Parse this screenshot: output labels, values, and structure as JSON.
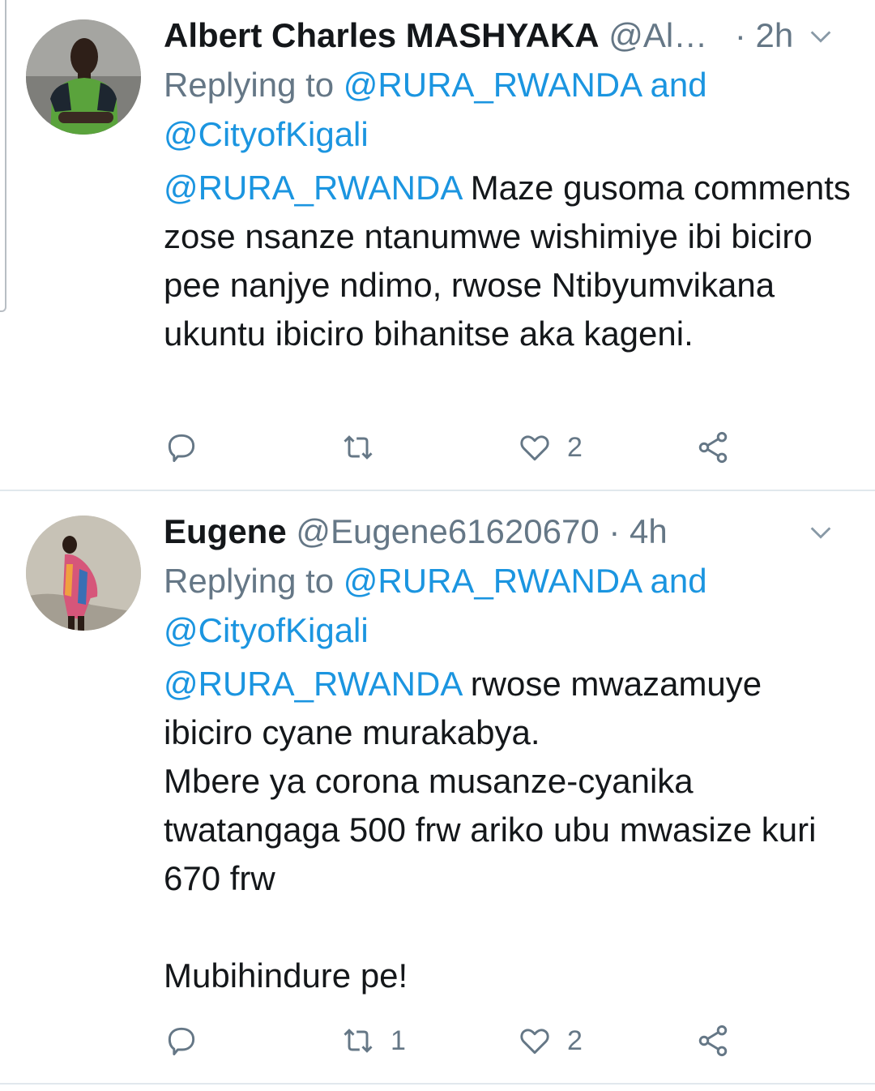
{
  "tweets": [
    {
      "name": "Albert Charles MASHYAKA",
      "handle": "@Al…",
      "time": "· 2h",
      "replying_prefix": "Replying to ",
      "replying_mention1": "@RURA_RWANDA",
      "replying_and": " and",
      "replying_mention2": "@CityofKigali",
      "body_mention": "@RURA_RWANDA",
      "body_text": " Maze gusoma comments zose nsanze ntanumwe wishimiye ibi biciro pee nanjye ndimo, rwose Ntibyumvikana ukuntu ibiciro bihanitse aka kageni.",
      "retweet_count": "",
      "like_count": "2",
      "avatar_icon": "profile-photo-green-shirt"
    },
    {
      "name": "Eugene",
      "handle": "@Eugene61620670",
      "time": "· 4h",
      "replying_prefix": "Replying to ",
      "replying_mention1": "@RURA_RWANDA",
      "replying_and": " and",
      "replying_mention2": "@CityofKigali",
      "body_mention": "@RURA_RWANDA",
      "body_text": " rwose mwazamuye ibiciro cyane murakabya.\nMbere ya corona musanze-cyanika twatangaga 500 frw ariko ubu mwasize kuri 670 frw\n\nMubihindure pe!",
      "retweet_count": "1",
      "like_count": "2",
      "avatar_icon": "profile-photo-patterned-shirt"
    }
  ],
  "colors": {
    "link": "#1b95e0",
    "secondary": "#657786",
    "text": "#14171a",
    "divider": "#e1e8ed"
  },
  "icons": [
    "reply-icon",
    "retweet-icon",
    "like-icon",
    "share-icon",
    "chevron-down-icon"
  ]
}
